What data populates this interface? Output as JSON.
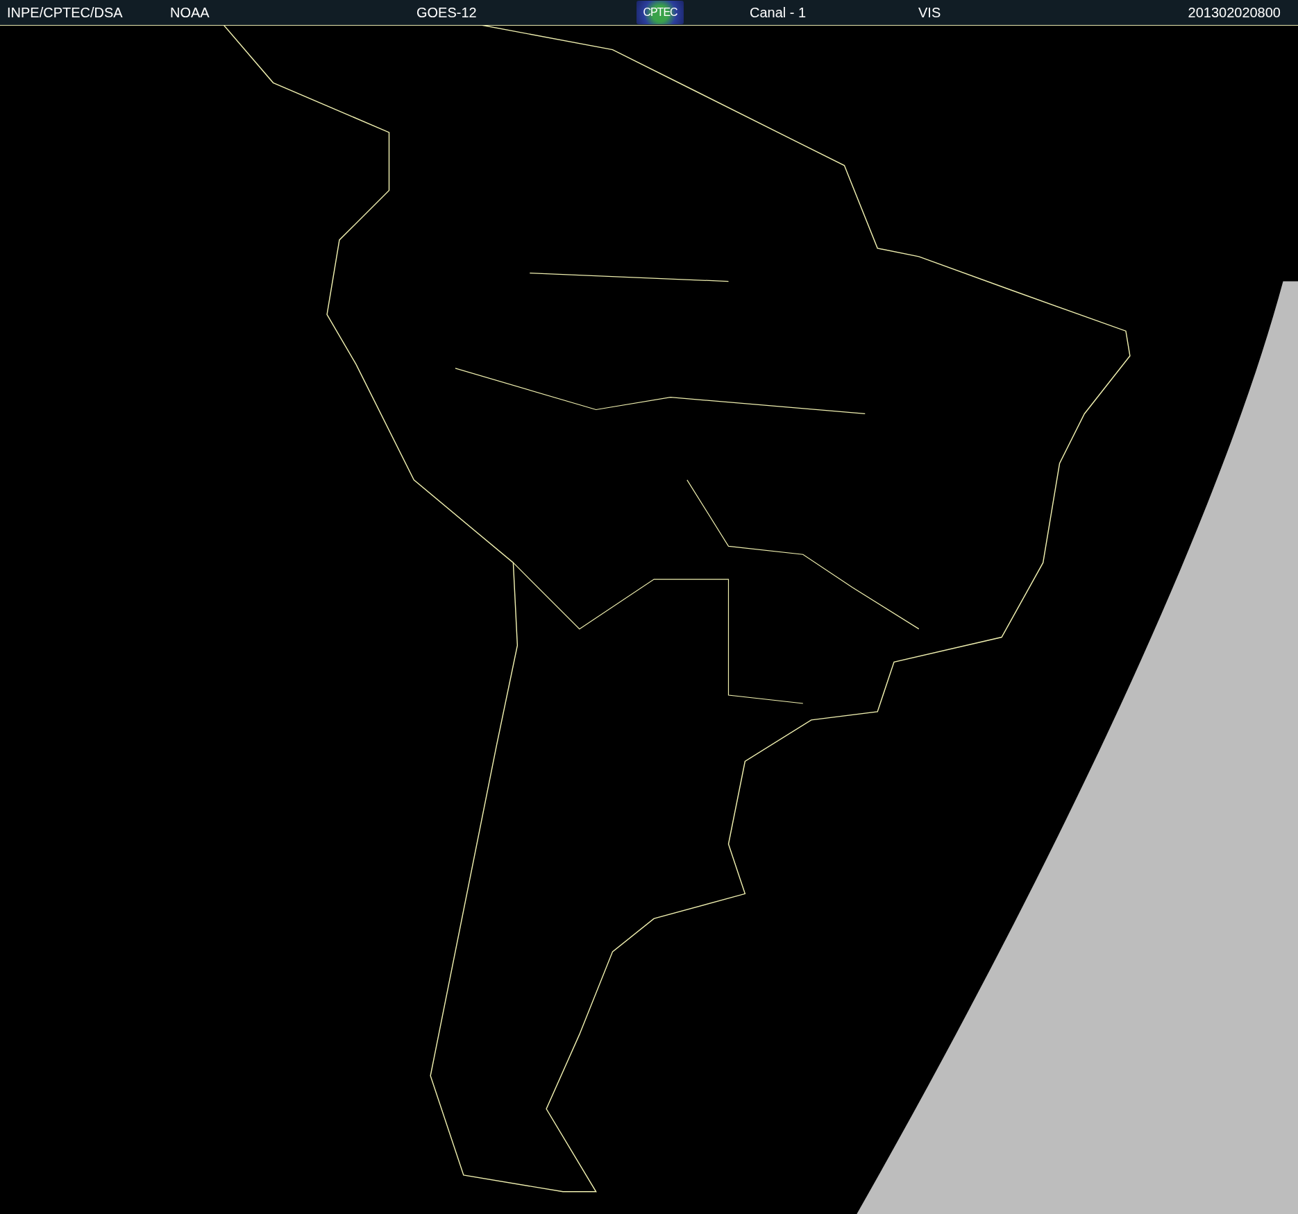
{
  "header": {
    "items": [
      {
        "kind": "text",
        "text": "INPE/CPTEC/DSA"
      },
      {
        "kind": "text",
        "text": "NOAA"
      },
      {
        "kind": "text",
        "text": "GOES-12"
      },
      {
        "kind": "logo",
        "text": "CPTEC"
      },
      {
        "kind": "text",
        "text": "Canal - 1"
      },
      {
        "kind": "text",
        "text": "VIS"
      },
      {
        "kind": "text",
        "text": "201302020800"
      }
    ]
  }
}
